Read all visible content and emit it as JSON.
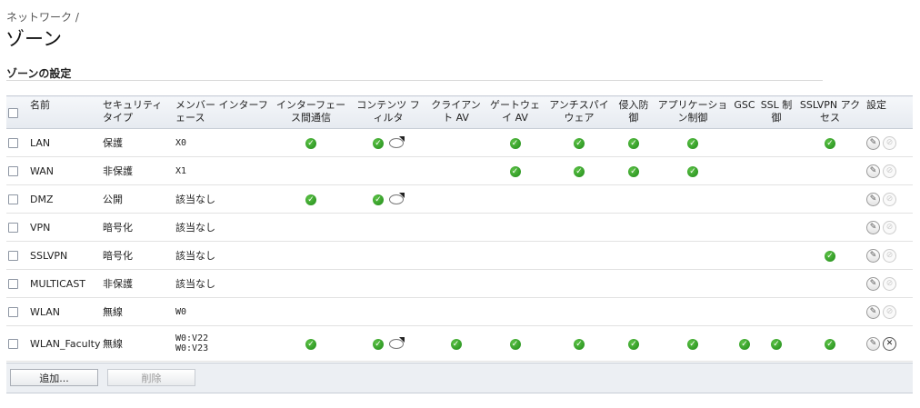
{
  "breadcrumb": "ネットワーク /",
  "page_title": "ゾーン",
  "section_title": "ゾーンの設定",
  "columns": {
    "name": "名前",
    "security_type": "セキュリティタイプ",
    "member_interface": "メンバー インターフェース",
    "interzone": "インターフェース間通信",
    "content_filter": "コンテンツ フィルタ",
    "client_av": "クライアント AV",
    "gateway_av": "ゲートウェイ AV",
    "antispyware": "アンチスパイウェア",
    "ips": "侵入防御",
    "app_control": "アプリケーション制御",
    "gsc": "GSC",
    "ssl_control": "SSL 制御",
    "sslvpn_access": "SSLVPN アクセス",
    "settings": "設定"
  },
  "rows": [
    {
      "name": "LAN",
      "security": "保護",
      "iface1": "X0",
      "iface2": ""
    },
    {
      "name": "WAN",
      "security": "非保護",
      "iface1": "X1",
      "iface2": ""
    },
    {
      "name": "DMZ",
      "security": "公開",
      "iface1": "該当なし",
      "iface2": ""
    },
    {
      "name": "VPN",
      "security": "暗号化",
      "iface1": "該当なし",
      "iface2": ""
    },
    {
      "name": "SSLVPN",
      "security": "暗号化",
      "iface1": "該当なし",
      "iface2": ""
    },
    {
      "name": "MULTICAST",
      "security": "非保護",
      "iface1": "該当なし",
      "iface2": ""
    },
    {
      "name": "WLAN",
      "security": "無線",
      "iface1": "W0",
      "iface2": ""
    },
    {
      "name": "WLAN_Faculty",
      "security": "無線",
      "iface1": "W0:V22",
      "iface2": "W0:V23"
    }
  ],
  "buttons": {
    "add": "追加...",
    "delete": "削除"
  },
  "icons": {
    "check": "check-circle-icon",
    "comment": "comment-bubble-icon",
    "edit": "pencil-edit-icon",
    "delete_disabled": "delete-disabled-icon",
    "delete_enabled": "delete-x-icon"
  },
  "colors": {
    "check_green": "#2e9b22",
    "header_bg": "#e6eaf0"
  }
}
